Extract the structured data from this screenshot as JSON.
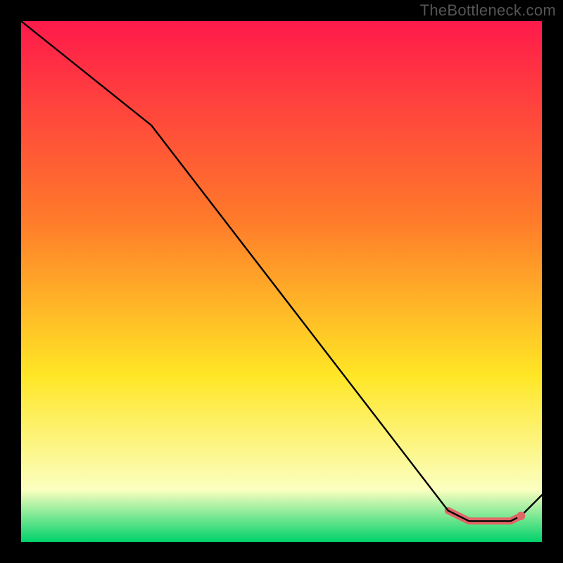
{
  "watermark": "TheBottleneck.com",
  "colors": {
    "gradient_top": "#ff1a4b",
    "gradient_mid1": "#ff7a2a",
    "gradient_mid2": "#ffe625",
    "gradient_low": "#fbffc0",
    "gradient_bottom": "#00d26a",
    "curve": "#000000",
    "highlight": "#e06666"
  },
  "chart_data": {
    "type": "line",
    "title": "",
    "xlabel": "",
    "ylabel": "",
    "xlim": [
      0,
      100
    ],
    "ylim": [
      0,
      100
    ],
    "series": [
      {
        "name": "curve",
        "x": [
          0,
          25,
          82,
          86,
          94,
          96,
          100
        ],
        "y": [
          100,
          80,
          6,
          4,
          4,
          5,
          9
        ]
      }
    ],
    "highlight_segment": {
      "x": [
        82,
        86,
        94,
        96
      ],
      "y": [
        6,
        4,
        4,
        5
      ]
    },
    "highlight_point": {
      "x": 96,
      "y": 5
    }
  }
}
